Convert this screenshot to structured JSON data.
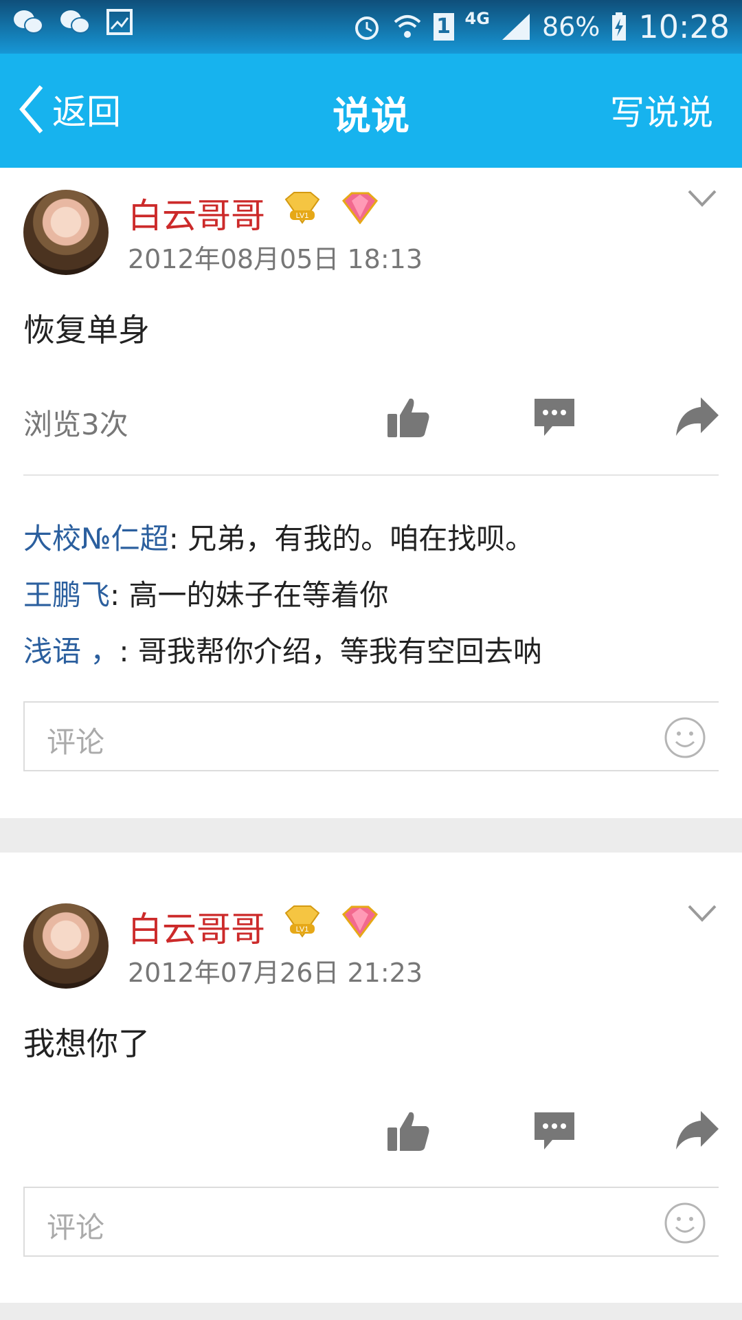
{
  "status_bar": {
    "battery": "86%",
    "time": "10:28",
    "network": "4G",
    "sim": "1",
    "left_icons": [
      "wechat-icon",
      "wechat-icon",
      "gallery-icon"
    ],
    "right_icons": [
      "alarm-icon",
      "wifi-icon",
      "sim-icon",
      "signal-icon",
      "battery-charging-icon"
    ]
  },
  "header": {
    "back_label": "返回",
    "title": "说说",
    "write_label": "写说说",
    "background": "#17b3ee"
  },
  "posts": [
    {
      "author": "白云哥哥",
      "badges": [
        "LV1",
        "diamond-icon"
      ],
      "date": "2012年08月05日 18:13",
      "content": "恢复单身",
      "views": "浏览3次",
      "comments": [
        {
          "who": "大校№仁超",
          "text": ": 兄弟，有我的。咱在找呗。"
        },
        {
          "who": "王鹏飞",
          "text": ": 高一的妹子在等着你"
        },
        {
          "who": "浅语 ，",
          "text": ": 哥我帮你介绍，等我有空回去呐"
        }
      ],
      "comment_placeholder": "评论"
    },
    {
      "author": "白云哥哥",
      "badges": [
        "LV1",
        "diamond-icon"
      ],
      "date": "2012年07月26日 21:23",
      "content": "我想你了",
      "comment_placeholder": "评论"
    }
  ],
  "colors": {
    "author_name": "#cc2a2a",
    "commenter": "#2b5f9e",
    "action_icon": "#777777"
  }
}
